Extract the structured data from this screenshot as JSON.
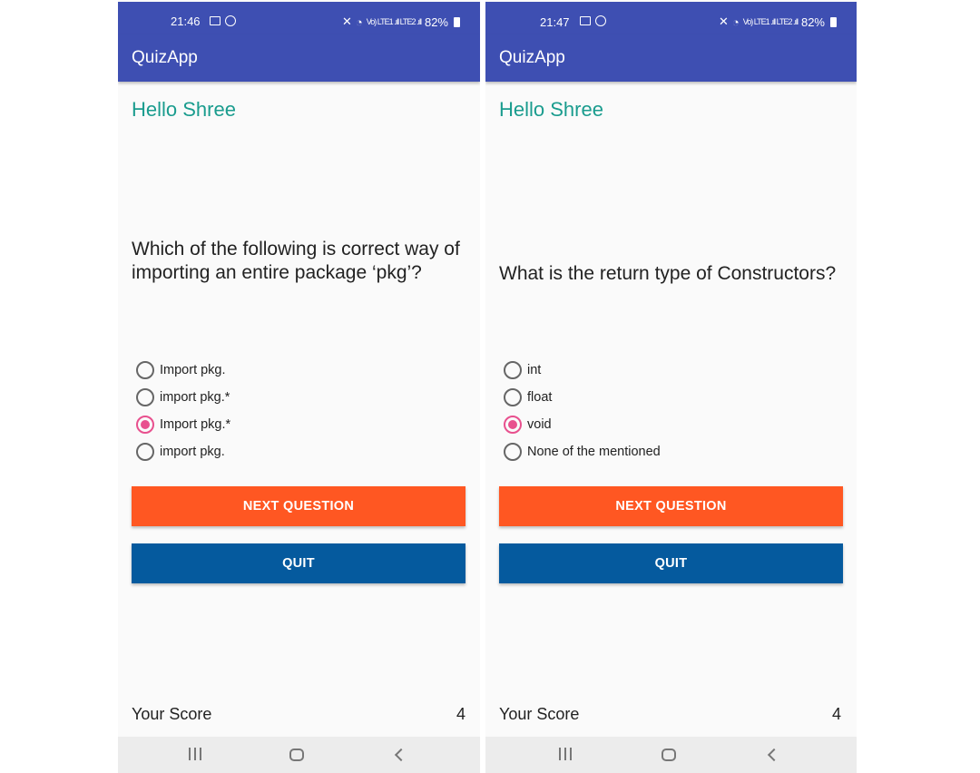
{
  "screens": [
    {
      "status": {
        "time": "21:46",
        "battery": "82%",
        "signal": "Vo) LTE1 .ıll LTE2 .ıll"
      },
      "app_title": "QuizApp",
      "greeting": "Hello Shree",
      "question": "Which of the following is correct way of importing an entire package ‘pkg’?",
      "options": [
        {
          "label": "Import pkg.",
          "checked": false
        },
        {
          "label": "import pkg.*",
          "checked": false
        },
        {
          "label": "Import pkg.*",
          "checked": true
        },
        {
          "label": "import pkg.",
          "checked": false
        }
      ],
      "next_label": "NEXT QUESTION",
      "quit_label": "QUIT",
      "score_label": "Your Score",
      "score_value": "4"
    },
    {
      "status": {
        "time": "21:47",
        "battery": "82%",
        "signal": "Vo) LTE1 .ıll LTE2 .ıll"
      },
      "app_title": "QuizApp",
      "greeting": "Hello Shree",
      "question": "What is the return type of Constructors?",
      "options": [
        {
          "label": "int",
          "checked": false
        },
        {
          "label": "float",
          "checked": false
        },
        {
          "label": "void",
          "checked": true
        },
        {
          "label": "None of the mentioned",
          "checked": false
        }
      ],
      "next_label": "NEXT QUESTION",
      "quit_label": "QUIT",
      "score_label": "Your Score",
      "score_value": "4"
    }
  ],
  "colors": {
    "app_bar": "#3e4fb2",
    "greeting": "#1a9c8e",
    "radio_checked": "#e8508e",
    "next_button": "#ff5722",
    "quit_button": "#055a9e"
  },
  "icons": [
    "image-icon",
    "whatsapp-icon",
    "mute-icon",
    "wifi-icon",
    "signal-icon",
    "battery-icon",
    "recent-apps-icon",
    "home-icon",
    "back-icon"
  ]
}
